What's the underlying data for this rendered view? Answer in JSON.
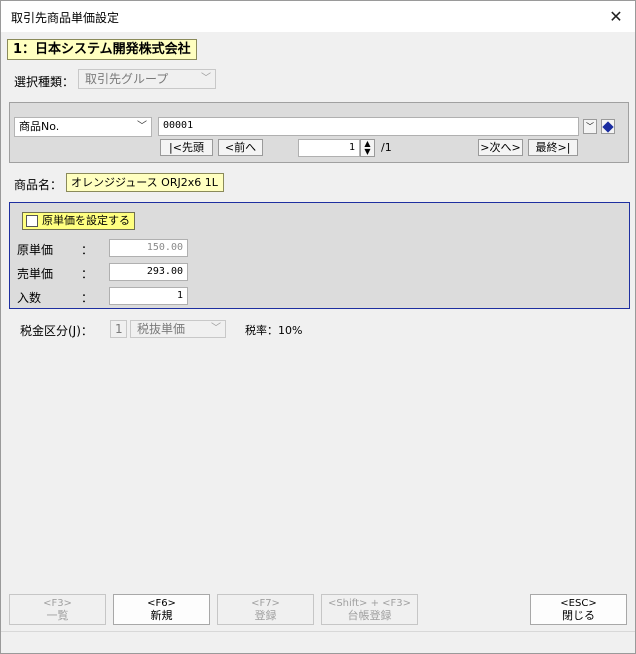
{
  "window": {
    "title": "取引先商品単価設定",
    "close_glyph": "✕"
  },
  "company": {
    "label": "1：日本システム開発株式会社"
  },
  "selection_type": {
    "label": "選択種類：",
    "value": "取引先グループ"
  },
  "nav": {
    "field_select": "商品No.",
    "code_value": "00001",
    "first_label": "|<先頭",
    "prev_label": "<前へ",
    "page_current": "1",
    "page_total": "/1",
    "next_label": ">次へ>",
    "last_label": "最終>|"
  },
  "product": {
    "label": "商品名：",
    "value": "オレンジジュース ORJ2x6 1L"
  },
  "price": {
    "set_cost_label": "原単価を設定する",
    "cost_label": "原単価",
    "cost_value": "150.00",
    "sell_label": "売単価",
    "sell_value": "293.00",
    "qty_label": "入数",
    "qty_value": "1",
    "colon": "："
  },
  "tax": {
    "label": "税金区分(J)：",
    "code": "1",
    "type": "税抜単価",
    "rate_label": "税率：10%"
  },
  "function_keys": [
    {
      "key": "<F3>",
      "label": "一覧",
      "enabled": false
    },
    {
      "key": "<F6>",
      "label": "新規",
      "enabled": true
    },
    {
      "key": "<F7>",
      "label": "登録",
      "enabled": false
    },
    {
      "key": "<Shift> + <F3>",
      "label": "台帳登録",
      "enabled": false
    },
    {
      "key": "<ESC>",
      "label": "閉じる",
      "enabled": true
    }
  ],
  "colors": {
    "company_bg": "#ffffc0",
    "checkbox_bg": "#ffff80",
    "panel_border": "#1e2fa0",
    "panel_bg": "#dcdcdc"
  }
}
